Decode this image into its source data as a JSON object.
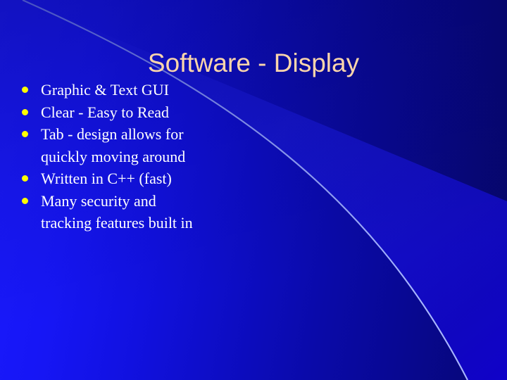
{
  "slide": {
    "title": "Software - Display",
    "title_color": "#fad5ab",
    "text_color": "#ffffff",
    "bullet_color": "#ffff00",
    "background": {
      "left_color": "#1a1aff",
      "right_color": "#060670",
      "accent_line_color": "#8fa0ff",
      "highlight_color": "#1400ff"
    },
    "bullets": [
      {
        "text": "Graphic & Text GUI"
      },
      {
        "text": "Clear - Easy to Read"
      },
      {
        "text": "Tab - design allows for quickly moving around"
      },
      {
        "text": "Written in C++ (fast)"
      },
      {
        "text": "Many security and tracking features built in"
      }
    ]
  }
}
